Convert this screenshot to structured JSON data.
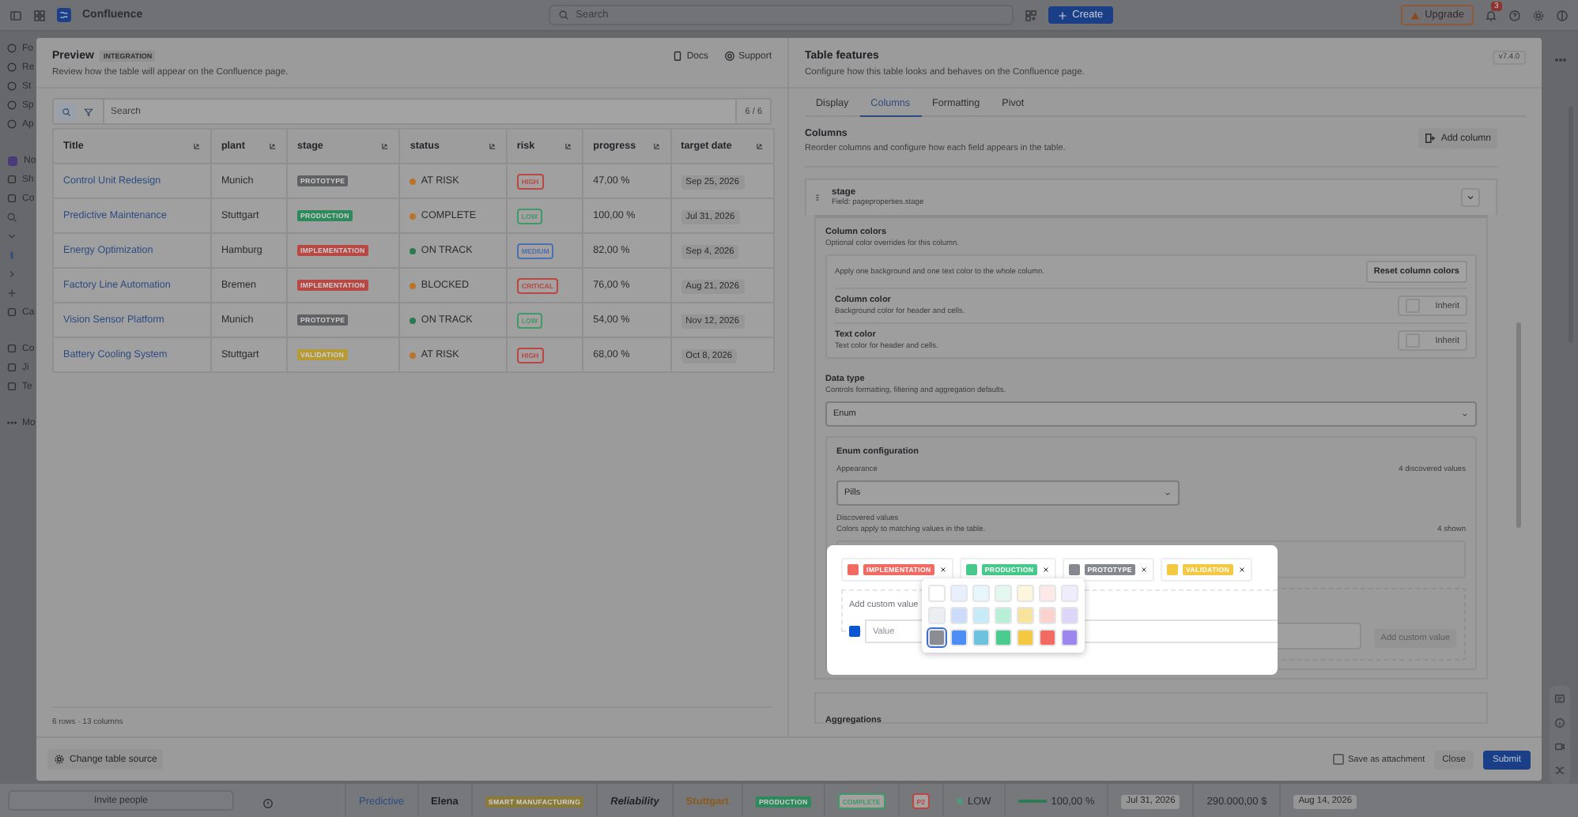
{
  "topbar": {
    "product": "Confluence",
    "search": {
      "placeholder": "Search"
    },
    "create": "Create",
    "upgrade": "Upgrade",
    "notifications": "3"
  },
  "sidebar": {
    "items": [
      {
        "label": "Fo"
      },
      {
        "label": "Re"
      },
      {
        "label": "St"
      },
      {
        "label": "Sp"
      },
      {
        "label": "Ap"
      }
    ],
    "space": {
      "label": "No"
    },
    "space_items": [
      {
        "label": "Sh"
      },
      {
        "label": "Co"
      }
    ],
    "lower_items": [
      {
        "label": "Ca"
      }
    ],
    "apps": [
      {
        "label": "Co"
      },
      {
        "label": "Ji"
      },
      {
        "label": "Te"
      }
    ],
    "more": "Mo",
    "invite": "Invite people"
  },
  "background_row": [
    {
      "kind": "link",
      "text": "Predictive"
    },
    {
      "kind": "bold",
      "text": "Elena"
    },
    {
      "kind": "pill",
      "text": "SMART MANUFACTURING",
      "color": "#8a7a3a"
    },
    {
      "kind": "italic",
      "text": "Reliability"
    },
    {
      "kind": "accent",
      "text": "Stuttgart"
    },
    {
      "kind": "pill",
      "text": "PRODUCTION",
      "color": "#2e8a5c"
    },
    {
      "kind": "outline",
      "text": "COMPLETE",
      "color": "#3f9a6a"
    },
    {
      "kind": "outline",
      "text": "P2",
      "color": "#b84844"
    },
    {
      "kind": "dot",
      "text": "LOW",
      "color": "#4f9a7a"
    },
    {
      "kind": "bar",
      "text": "100,00 %",
      "level": 1
    },
    {
      "kind": "date",
      "text": "Jul 31, 2026"
    },
    {
      "kind": "text",
      "text": "290.000,00 $"
    },
    {
      "kind": "date",
      "text": "Aug 14, 2026"
    }
  ],
  "preview": {
    "title": "Preview",
    "badge": "INTEGRATION",
    "description": "Review how the table will appear on the Confluence page.",
    "links": [
      "Docs",
      "Support"
    ],
    "search": {
      "placeholder": "Search",
      "count": "6 / 6"
    },
    "table": {
      "columns": [
        "Title",
        "plant",
        "stage",
        "status",
        "risk",
        "progress",
        "target date"
      ],
      "rows": [
        {
          "title": "Control Unit Redesign",
          "plant": "Munich",
          "stage": {
            "label": "PROTOTYPE",
            "color": "#5f6165"
          },
          "status": {
            "label": "AT RISK",
            "color": "#b8742a"
          },
          "risk": {
            "label": "HIGH",
            "color": "#b84844"
          },
          "progress": "47,00 %",
          "target_date": "Sep 25, 2026"
        },
        {
          "title": "Predictive Maintenance",
          "plant": "Stuttgart",
          "stage": {
            "label": "PRODUCTION",
            "color": "#2e8a5c"
          },
          "status": {
            "label": "COMPLETE",
            "color": "#b8742a"
          },
          "risk": {
            "label": "LOW",
            "color": "#3f9a6a"
          },
          "progress": "100,00 %",
          "target_date": "Jul 31, 2026"
        },
        {
          "title": "Energy Optimization",
          "plant": "Hamburg",
          "stage": {
            "label": "IMPLEMENTATION",
            "color": "#b84844"
          },
          "status": {
            "label": "ON TRACK",
            "color": "#2a7a4e"
          },
          "risk": {
            "label": "MEDIUM",
            "color": "#4a72b0"
          },
          "progress": "82,00 %",
          "target_date": "Sep 4, 2026"
        },
        {
          "title": "Factory Line Automation",
          "plant": "Bremen",
          "stage": {
            "label": "IMPLEMENTATION",
            "color": "#b84844"
          },
          "status": {
            "label": "BLOCKED",
            "color": "#b8742a"
          },
          "risk": {
            "label": "CRITICAL",
            "color": "#b84844"
          },
          "progress": "76,00 %",
          "target_date": "Aug 21, 2026"
        },
        {
          "title": "Vision Sensor Platform",
          "plant": "Munich",
          "stage": {
            "label": "PROTOTYPE",
            "color": "#5f6165"
          },
          "status": {
            "label": "ON TRACK",
            "color": "#2a7a4e"
          },
          "risk": {
            "label": "LOW",
            "color": "#3f9a6a"
          },
          "progress": "54,00 %",
          "target_date": "Nov 12, 2026"
        },
        {
          "title": "Battery Cooling System",
          "plant": "Stuttgart",
          "stage": {
            "label": "VALIDATION",
            "color": "#b59b35"
          },
          "status": {
            "label": "AT RISK",
            "color": "#b8742a"
          },
          "risk": {
            "label": "HIGH",
            "color": "#b84844"
          },
          "progress": "68,00 %",
          "target_date": "Oct 8, 2026"
        }
      ]
    },
    "summary": "6 rows · 13 columns",
    "change_source": "Change table source"
  },
  "features": {
    "title": "Table features",
    "description": "Configure how this table looks and behaves on the Confluence page.",
    "version": "v7.4.0",
    "tabs": [
      {
        "label": "Display",
        "selected": false
      },
      {
        "label": "Columns",
        "selected": true
      },
      {
        "label": "Formatting",
        "selected": false
      },
      {
        "label": "Pivot",
        "selected": false
      }
    ],
    "columns_section": {
      "title": "Columns",
      "description": "Reorder columns and configure how each field appears in the table.",
      "add_button": "Add column"
    },
    "column": {
      "name": "stage",
      "field": "Field: pageproperties.stage",
      "colors": {
        "title": "Column colors",
        "description": "Optional color overrides for this column.",
        "note": "Apply one background and one text color to the whole column.",
        "reset": "Reset column colors",
        "rows": [
          {
            "label": "Column color",
            "description": "Background color for header and cells.",
            "value": "Inherit"
          },
          {
            "label": "Text color",
            "description": "Text color for header and cells.",
            "value": "Inherit"
          }
        ]
      },
      "data_type": {
        "title": "Data type",
        "description": "Controls formatting, filtering and aggregation defaults.",
        "value": "Enum"
      },
      "enum": {
        "title": "Enum configuration",
        "appearance_label": "Appearance",
        "appearance": "Pills",
        "discovered_count": "4 discovered values",
        "discovered_title": "Discovered values",
        "discovered_description": "Colors apply to matching values in the table.",
        "shown": "4 shown",
        "values": [
          {
            "label": "IMPLEMENTATION",
            "color": "#f26b62"
          },
          {
            "label": "PRODUCTION",
            "color": "#46c98b"
          },
          {
            "label": "PROTOTYPE",
            "color": "#868890"
          },
          {
            "label": "VALIDATION",
            "color": "#f5c842"
          }
        ],
        "custom": {
          "label": "Add custom value",
          "color": "#0c56d0",
          "placeholder": "Value",
          "button": "Add custom value"
        },
        "palette": [
          {
            "color": "#ffffff",
            "selected": false
          },
          {
            "color": "#e9f0fd",
            "selected": false
          },
          {
            "color": "#e6f6fb",
            "selected": false
          },
          {
            "color": "#e3f7ef",
            "selected": false
          },
          {
            "color": "#fdf6dc",
            "selected": false
          },
          {
            "color": "#fde9e7",
            "selected": false
          },
          {
            "color": "#efedfb",
            "selected": false
          },
          {
            "color": "#eceef1",
            "selected": false
          },
          {
            "color": "#cddcfb",
            "selected": false
          },
          {
            "color": "#c6ebf7",
            "selected": false
          },
          {
            "color": "#b9efd6",
            "selected": false
          },
          {
            "color": "#f7e39c",
            "selected": false
          },
          {
            "color": "#fbd2ce",
            "selected": false
          },
          {
            "color": "#ddd6f8",
            "selected": false
          },
          {
            "color": "#8a8d93",
            "selected": true
          },
          {
            "color": "#4c8df6",
            "selected": false
          },
          {
            "color": "#6cc3de",
            "selected": false
          },
          {
            "color": "#4bcb8e",
            "selected": false
          },
          {
            "color": "#f5c842",
            "selected": false
          },
          {
            "color": "#f26b62",
            "selected": false
          },
          {
            "color": "#9d87ee",
            "selected": false
          }
        ]
      },
      "aggregations": "Aggregations"
    },
    "save_attachment": {
      "label": "Save as attachment",
      "checked": false
    },
    "close": "Close",
    "submit": "Submit"
  }
}
